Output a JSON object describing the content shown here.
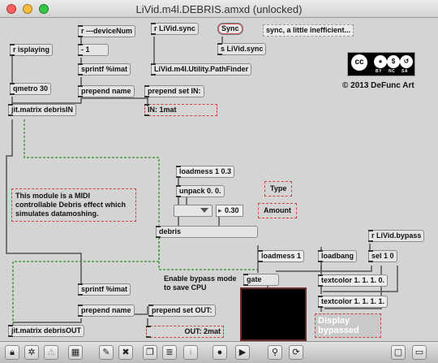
{
  "window": {
    "title": "LiVid.m4l.DEBRIS.amxd (unlocked)"
  },
  "objects": {
    "r_device_num": "r ---deviceNum",
    "r_isplaying": "r isplaying",
    "minus_one": "- 1",
    "sprintf_top": "sprintf %imat",
    "qmetro": "qmetro 30",
    "prepend_name_top": "prepend name",
    "prepend_set_in": "prepend set IN:",
    "in_value": "IN: 1mat",
    "jit_matrix_in": "jit.matrix debrisIN",
    "r_livid_sync": "r LiVid.sync",
    "sync_button": "Sync",
    "sync_comment": "sync, a little inefficient...",
    "s_livid_sync": "s LiVid.sync",
    "path_finder": "LiVid.m4l.Utility.PathFinder",
    "loadmess_03": "loadmess 1 0.3",
    "unpack": "unpack 0. 0.",
    "type_label": "Type",
    "amount_value": "0.30",
    "amount_label": "Amount",
    "module_comment": "This module is a MIDI controllable Debris effect which simulates datamoshing.",
    "debris": "debris",
    "r_livid_bypass": "r LiVid.bypass",
    "loadmess_1": "loadmess 1",
    "loadbang": "loadbang",
    "sel_10": "sel 1 0",
    "bypass_comment": "Enable bypass mode to save CPU",
    "gate": "gate",
    "textcolor_a": "textcolor 1. 1. 1. 0.",
    "textcolor_b": "textcolor 1. 1. 1. 1.",
    "display_bypassed": "Display bypassed",
    "sprintf_bottom": "sprintf %imat",
    "prepend_name_bottom": "prepend name",
    "prepend_set_out": "prepend set OUT:",
    "out_value": "OUT: 2mat",
    "jit_matrix_out": "jit.matrix debrisOUT"
  },
  "license": {
    "cc_letters": "cc",
    "by": "BY",
    "nc": "NC",
    "sa": "SA",
    "credit": "© 2013 DeFunc Art"
  },
  "toolbar": {
    "icons": [
      "lock-icon",
      "presentation-icon",
      "warning-icon",
      "grid-icon",
      "edit-icon",
      "cut-icon",
      "duplicate-icon",
      "list-icon",
      "info-icon",
      "connect-icon",
      "play-icon",
      "tree-icon",
      "refresh-icon",
      "window-icon",
      "minimize-icon"
    ]
  },
  "colors": {
    "patchcord": "#555555",
    "signal_cord": "#4a9a44",
    "dashed_border": "#cc4444",
    "display_bg": "#000000"
  }
}
